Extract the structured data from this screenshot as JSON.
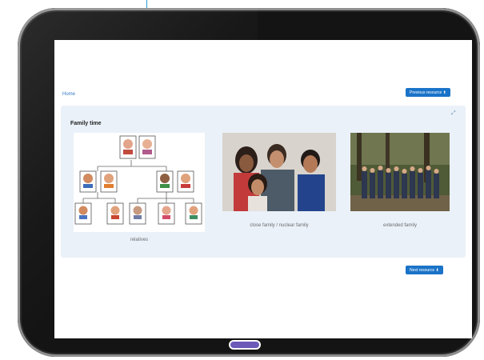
{
  "screen": {
    "breadcrumb": "Home",
    "previous_button": "Previous resource ⬆",
    "next_button": "Next resource ⬇"
  },
  "card": {
    "title": "Family time",
    "items": [
      {
        "caption": "relatives"
      },
      {
        "caption": "close family / nuclear family"
      },
      {
        "caption": "extended family"
      }
    ]
  },
  "icons": {
    "expand": "expand-icon",
    "home": "home-button-icon"
  },
  "colors": {
    "accent": "#1a73c8",
    "card_background": "#eaf1f9",
    "bezel": "#141414"
  }
}
